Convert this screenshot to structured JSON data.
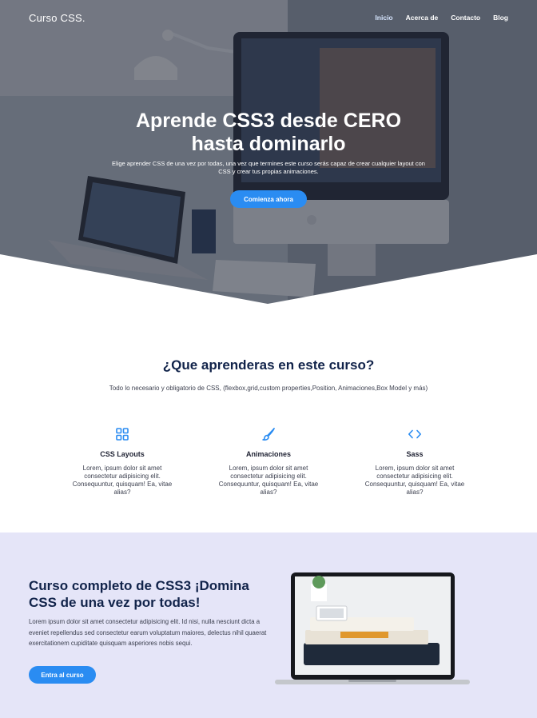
{
  "brand": "Curso CSS.",
  "nav": {
    "items": [
      "Inicio",
      "Acerca de",
      "Contacto",
      "Blog"
    ],
    "active": "Inicio"
  },
  "hero": {
    "title_line1": "Aprende CSS3 desde CERO",
    "title_line2": "hasta dominarlo",
    "subtitle": "Elige aprender CSS de una vez por todas, una vez que termines este curso serás capaz de crear cualquier layout con CSS y crear tus propias animaciones.",
    "cta": "Comienza ahora"
  },
  "features": {
    "title": "¿Que aprenderas en este curso?",
    "subtitle": "Todo lo necesario y obligatorio de CSS, (flexbox,grid,custom properties,Position, Animaciones,Box Model y más)",
    "items": [
      {
        "icon": "grid-icon",
        "title": "CSS Layouts",
        "text": "Lorem, ipsum dolor sit amet consectetur adipisicing elit. Consequuntur, quisquam! Ea, vitae alias?"
      },
      {
        "icon": "brush-icon",
        "title": "Animaciones",
        "text": "Lorem, ipsum dolor sit amet consectetur adipisicing elit. Consequuntur, quisquam! Ea, vitae alias?"
      },
      {
        "icon": "code-icon",
        "title": "Sass",
        "text": "Lorem, ipsum dolor sit amet consectetur adipisicing elit. Consequuntur, quisquam! Ea, vitae alias?"
      }
    ]
  },
  "course": {
    "title": "Curso completo de CSS3 ¡Domina CSS de una vez por todas!",
    "text": "Lorem ipsum dolor sit amet consectetur adipisicing elit. Id nisi, nulla nesciunt dicta a eveniet repellendus sed consectetur earum voluptatum maiores, delectus nihil quaerat exercitationem cupiditate quisquam asperiores nobis sequi.",
    "cta": "Entra al curso"
  },
  "colors": {
    "accent": "#2a8cf2",
    "heading": "#11234a",
    "course_bg": "#e5e5f8"
  }
}
